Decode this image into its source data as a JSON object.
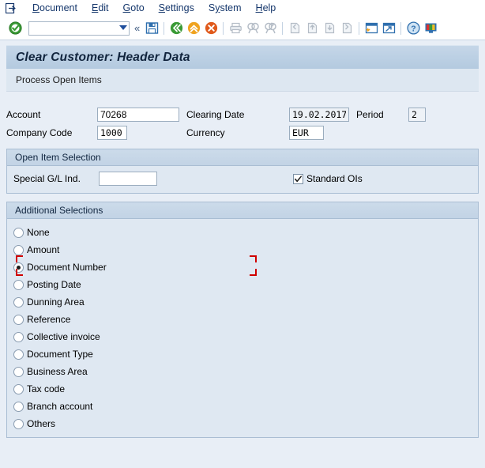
{
  "menubar": {
    "system_icon": "window-menu-icon",
    "items": [
      {
        "label": "Document",
        "accel": "D"
      },
      {
        "label": "Edit",
        "accel": "E"
      },
      {
        "label": "Goto",
        "accel": "G"
      },
      {
        "label": "Settings",
        "accel": "S"
      },
      {
        "label": "System",
        "accel": "y"
      },
      {
        "label": "Help",
        "accel": "H"
      }
    ]
  },
  "toolbar": {
    "enter_icon": "green-check-icon",
    "command_field_value": "",
    "command_field_placeholder": "",
    "dropdown_icon": "chevron-down-icon",
    "collapse_icon": "«",
    "icons": [
      {
        "name": "save-icon",
        "tooltip": "Save"
      },
      {
        "name": "back-icon",
        "tooltip": "Back"
      },
      {
        "name": "exit-icon",
        "tooltip": "Exit"
      },
      {
        "name": "cancel-icon",
        "tooltip": "Cancel"
      },
      {
        "name": "print-icon",
        "tooltip": "Print"
      },
      {
        "name": "find-icon",
        "tooltip": "Find"
      },
      {
        "name": "find-next-icon",
        "tooltip": "Find Next"
      },
      {
        "name": "first-page-icon",
        "tooltip": "First Page"
      },
      {
        "name": "previous-page-icon",
        "tooltip": "Previous Page"
      },
      {
        "name": "next-page-icon",
        "tooltip": "Next Page"
      },
      {
        "name": "last-page-icon",
        "tooltip": "Last Page"
      },
      {
        "name": "create-session-icon",
        "tooltip": "Create New Session"
      },
      {
        "name": "create-shortcut-icon",
        "tooltip": "Create Shortcut"
      },
      {
        "name": "help-icon",
        "tooltip": "Help"
      },
      {
        "name": "customize-layout-icon",
        "tooltip": "Customize Local Layout"
      }
    ]
  },
  "screen": {
    "title": "Clear Customer: Header Data",
    "subtitle": "Process Open Items"
  },
  "header_form": {
    "account_label": "Account",
    "account_value": "70268",
    "clearing_date_label": "Clearing Date",
    "clearing_date_value": "19.02.2017",
    "period_label": "Period",
    "period_value": "2",
    "company_code_label": "Company Code",
    "company_code_value": "1000",
    "currency_label": "Currency",
    "currency_value": "EUR"
  },
  "open_item_selection": {
    "legend": "Open Item Selection",
    "special_gl_label": "Special G/L Ind.",
    "special_gl_value": "",
    "standard_ois_label": "Standard OIs",
    "standard_ois_checked": true,
    "check_glyph": "✓"
  },
  "additional_selections": {
    "legend": "Additional Selections",
    "selected": "Document Number",
    "options": [
      {
        "label": "None",
        "checked": false
      },
      {
        "label": "Amount",
        "checked": false
      },
      {
        "label": "Document Number",
        "checked": true
      },
      {
        "label": "Posting Date",
        "checked": false
      },
      {
        "label": "Dunning Area",
        "checked": false
      },
      {
        "label": "Reference",
        "checked": false
      },
      {
        "label": "Collective invoice",
        "checked": false
      },
      {
        "label": "Document Type",
        "checked": false
      },
      {
        "label": "Business Area",
        "checked": false
      },
      {
        "label": "Tax code",
        "checked": false
      },
      {
        "label": "Branch account",
        "checked": false
      },
      {
        "label": "Others",
        "checked": false
      }
    ]
  },
  "colors": {
    "page_background": "#e8eef6",
    "title_bar": "#bcd0e4",
    "group_background": "#dfe8f2",
    "group_header": "#c6d6e7",
    "focus_marker": "#d00000",
    "menu_text": "#14366b"
  }
}
